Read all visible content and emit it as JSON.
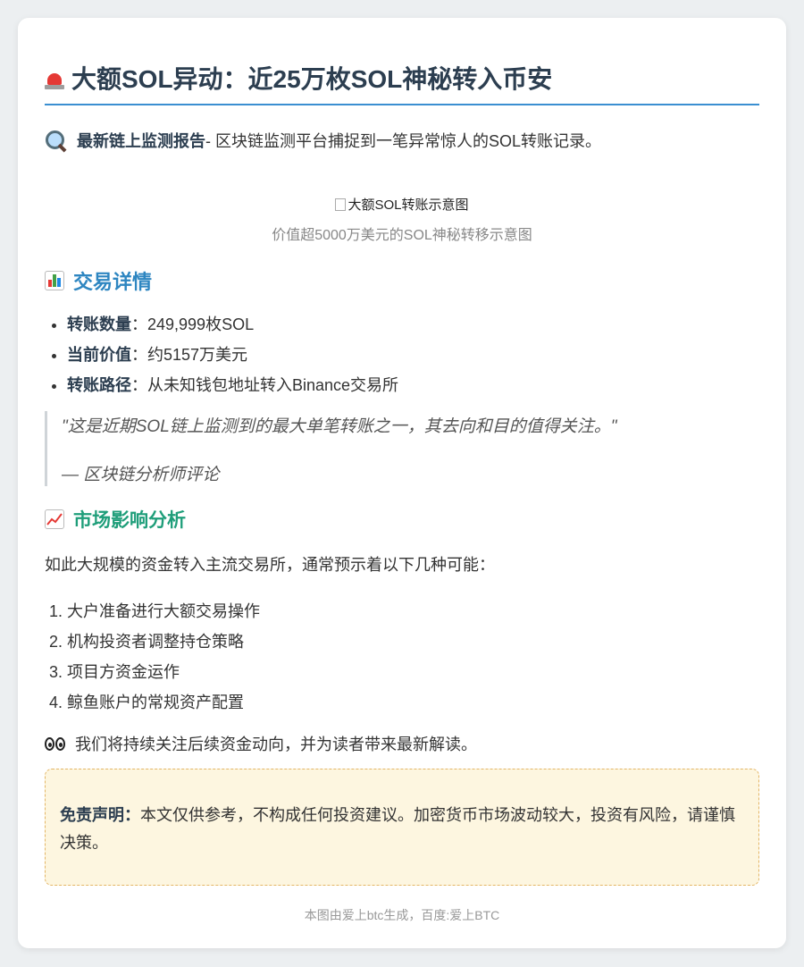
{
  "title": "大额SOL异动：近25万枚SOL神秘转入币安",
  "intro": {
    "bold": "最新链上监测报告",
    "text": " - 区块链监测平台捕捉到一笔异常惊人的SOL转账记录。"
  },
  "image": {
    "alt": "大额SOL转账示意图",
    "caption": "价值超5000万美元的SOL神秘转移示意图"
  },
  "details_heading": "交易详情",
  "details": [
    {
      "label": "转账数量",
      "value": "：249,999枚SOL"
    },
    {
      "label": "当前价值",
      "value": "：约5157万美元"
    },
    {
      "label": "转账路径",
      "value": "：从未知钱包地址转入Binance交易所"
    }
  ],
  "quote": {
    "text": "\"这是近期SOL链上监测到的最大单笔转账之一，其去向和目的值得关注。\"",
    "attribution": "— 区块链分析师评论"
  },
  "analysis_heading": "市场影响分析",
  "analysis_intro": "如此大规模的资金转入主流交易所，通常预示着以下几种可能：",
  "possibilities": [
    "大户准备进行大额交易操作",
    "机构投资者调整持仓策略",
    "项目方资金运作",
    "鲸鱼账户的常规资产配置"
  ],
  "follow_up": "我们将持续关注后续资金动向，并为读者带来最新解读。",
  "disclaimer": {
    "label": "免责声明：",
    "text": "本文仅供参考，不构成任何投资建议。加密货币市场波动较大，投资有风险，请谨慎决策。"
  },
  "footer": "本图由爱上btc生成，百度:爱上BTC",
  "colors": {
    "accent_blue": "#3a8fd1",
    "heading_blue": "#2e86c1",
    "heading_green": "#1f9e7a",
    "disclaimer_bg": "#fdf6e0",
    "disclaimer_border": "#e3b565"
  },
  "icons": {
    "title": "siren-icon",
    "intro": "magnifier-icon",
    "details": "bar-chart-icon",
    "analysis": "trend-up-icon",
    "follow_up": "eyes-icon"
  }
}
